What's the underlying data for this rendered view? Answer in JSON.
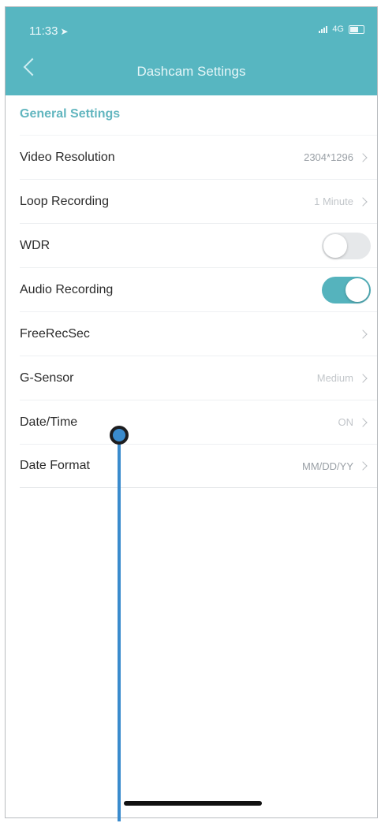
{
  "status_bar": {
    "time": "11:33",
    "network": "4G"
  },
  "header": {
    "title": "Dashcam Settings"
  },
  "section_title": "General Settings",
  "rows": [
    {
      "label": "Video Resolution",
      "value": "2304*1296",
      "type": "link"
    },
    {
      "label": "Loop Recording",
      "value": "1 Minute",
      "type": "link"
    },
    {
      "label": "WDR",
      "value": "",
      "type": "toggle",
      "on": false
    },
    {
      "label": "Audio Recording",
      "value": "",
      "type": "toggle",
      "on": true
    },
    {
      "label": "FreeRecSec",
      "value": "",
      "type": "link"
    },
    {
      "label": "G-Sensor",
      "value": "Medium",
      "type": "link"
    },
    {
      "label": "Date/Time",
      "value": "ON",
      "type": "link"
    },
    {
      "label": "Date Format",
      "value": "MM/DD/YY",
      "type": "link"
    }
  ],
  "colors": {
    "header": "#57b6c1",
    "toggle_on": "#55b3bd",
    "section_title": "#62b6bf",
    "pointer": "#3a8bcd"
  }
}
